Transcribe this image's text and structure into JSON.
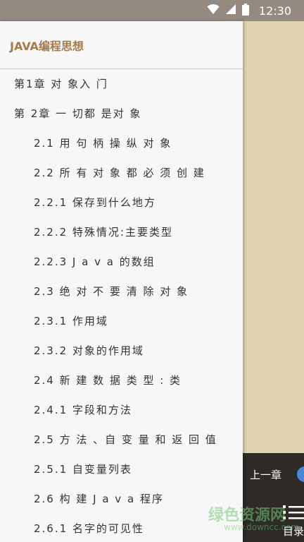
{
  "status_bar": {
    "time": "12:30",
    "icons": [
      "wifi-icon",
      "signal-icon",
      "battery-icon"
    ]
  },
  "drawer": {
    "book_title": "JAVA编程思想",
    "toc": [
      {
        "label": "第1章 对 象入 门",
        "level": 1
      },
      {
        "label": "第 2章 一 切都 是对 象",
        "level": 1
      },
      {
        "label": "2.1 用 句 柄 操 纵 对 象",
        "level": 2
      },
      {
        "label": "2.2 所 有 对 象 都 必 须 创 建",
        "level": 2
      },
      {
        "label": "2.2.1 保存到什么地方",
        "level": 2
      },
      {
        "label": "2.2.2 特殊情况:主要类型",
        "level": 2
      },
      {
        "label": "2.2.3 J a v a 的数组",
        "level": 2
      },
      {
        "label": "2.3 绝 对 不 要 清 除 对 象",
        "level": 2
      },
      {
        "label": "2.3.1 作用域",
        "level": 2
      },
      {
        "label": "2.3.2 对象的作用域",
        "level": 2
      },
      {
        "label": "2.4 新 建 数 据 类 型 : 类",
        "level": 2
      },
      {
        "label": "2.4.1 字段和方法",
        "level": 2
      },
      {
        "label": "2.5 方 法 、自 变 量 和 返 回 值",
        "level": 2
      },
      {
        "label": "2.5.1 自变量列表",
        "level": 2
      },
      {
        "label": "2.6 构 建 J a v a 程序",
        "level": 2
      },
      {
        "label": "2.6.1 名字的可见性",
        "level": 2
      }
    ]
  },
  "bottom_bar": {
    "prev_chapter": "上一章",
    "toc_label": "目录"
  },
  "watermark": {
    "text": "绿色资源网",
    "sub": "www.downcc.com"
  },
  "colors": {
    "status_bar": "#948a80",
    "page_background": "#e1d5b1",
    "drawer_background": "#f7f7f7",
    "title_accent": "#a57a4a",
    "bottom_bar": "#2d2a27",
    "progress_accent": "#4a86d9"
  }
}
